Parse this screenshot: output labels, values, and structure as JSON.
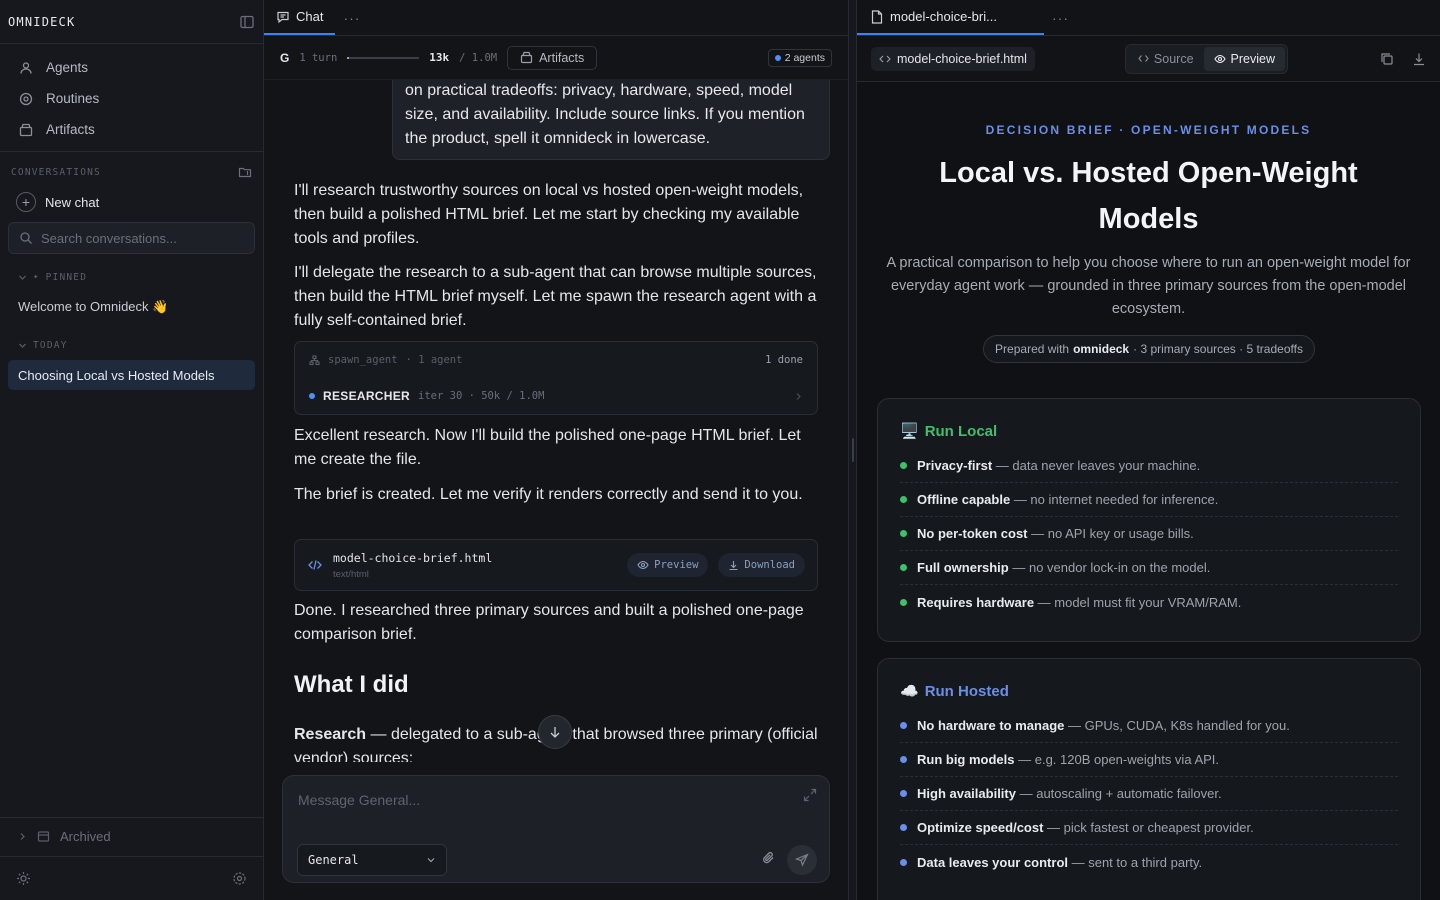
{
  "app": {
    "brand": "OMNIDECK"
  },
  "sidebar": {
    "nav": [
      {
        "label": "Agents",
        "icon": "users-icon"
      },
      {
        "label": "Routines",
        "icon": "routine-icon"
      },
      {
        "label": "Artifacts",
        "icon": "box-icon"
      }
    ],
    "conversations_title": "CONVERSATIONS",
    "new_chat": "New chat",
    "search_placeholder": "Search conversations...",
    "pinned_label": "PINNED",
    "pinned": [
      "Welcome to Omnideck 👋"
    ],
    "today_label": "TODAY",
    "today": [
      "Choosing Local vs Hosted Models"
    ],
    "archived": "Archived"
  },
  "chat": {
    "tab_label": "Chat",
    "stats": {
      "g": "G",
      "turns": "1 turn",
      "context_used": "13k",
      "context_max": "/ 1.0M",
      "context_fraction": 0.013
    },
    "artifacts_button": "Artifacts",
    "agents_badge": "2 agents",
    "user_message": "on practical tradeoffs: privacy, hardware, speed, model size, and availability. Include source links. If you mention the product, spell it omnideck in lowercase.",
    "messages": [
      "I'll research trustworthy sources on local vs hosted open-weight models, then build a polished HTML brief. Let me start by checking my available tools and profiles.",
      "I'll delegate the research to a sub-agent that can browse multiple sources, then build the HTML brief myself. Let me spawn the research agent with a fully self-contained brief.",
      "Excellent research. Now I'll build the polished one-page HTML brief. Let me create the file.",
      "The brief is created. Let me verify it renders correctly and send it to you.",
      "Done. I researched three primary sources and built a polished one-page comparison brief."
    ],
    "tool": {
      "name": "spawn_agent",
      "count": "· 1 agent",
      "status": "1 done",
      "agent": "RESEARCHER",
      "agent_meta": "iter 30 · 50k / 1.0M"
    },
    "file": {
      "name": "model-choice-brief.html",
      "type": "text/html",
      "preview": "Preview",
      "download": "Download"
    },
    "heading": "What I did",
    "research_label": "Research",
    "research_text": " — delegated to a sub-agent that browsed three primary (official vendor) sources:",
    "composer_placeholder": "Message General...",
    "profile_select": "General"
  },
  "preview": {
    "tab_label": "model-choice-bri...",
    "file_chip": "model-choice-brief.html",
    "source_label": "Source",
    "preview_label": "Preview",
    "doc": {
      "eyebrow": "DECISION BRIEF · OPEN-WEIGHT MODELS",
      "title": "Local vs. Hosted Open-Weight Models",
      "subtitle": "A practical comparison to help you choose where to run an open-weight model for everyday agent work — grounded in three primary sources from the open-model ecosystem.",
      "prepared_prefix": "Prepared with",
      "prepared_brand": "omnideck",
      "prepared_suffix": "· 3 primary sources · 5 tradeoffs",
      "local": {
        "emoji": "🖥️",
        "title": "Run Local",
        "color": "#3fc06b",
        "items": [
          {
            "b": "Privacy-first",
            "t": " — data never leaves your machine."
          },
          {
            "b": "Offline capable",
            "t": " — no internet needed for inference."
          },
          {
            "b": "No per-token cost",
            "t": " — no API key or usage bills."
          },
          {
            "b": "Full ownership",
            "t": " — no vendor lock-in on the model."
          },
          {
            "b": "Requires hardware",
            "t": " — model must fit your VRAM/RAM."
          }
        ]
      },
      "hosted": {
        "emoji": "☁️",
        "title": "Run Hosted",
        "color": "#6b8fe6",
        "items": [
          {
            "b": "No hardware to manage",
            "t": " — GPUs, CUDA, K8s handled for you."
          },
          {
            "b": "Run big models",
            "t": " — e.g. 120B open-weights via API."
          },
          {
            "b": "High availability",
            "t": " — autoscaling + automatic failover."
          },
          {
            "b": "Optimize speed/cost",
            "t": " — pick fastest or cheapest provider."
          },
          {
            "b": "Data leaves your control",
            "t": " — sent to a third party."
          }
        ]
      }
    }
  }
}
